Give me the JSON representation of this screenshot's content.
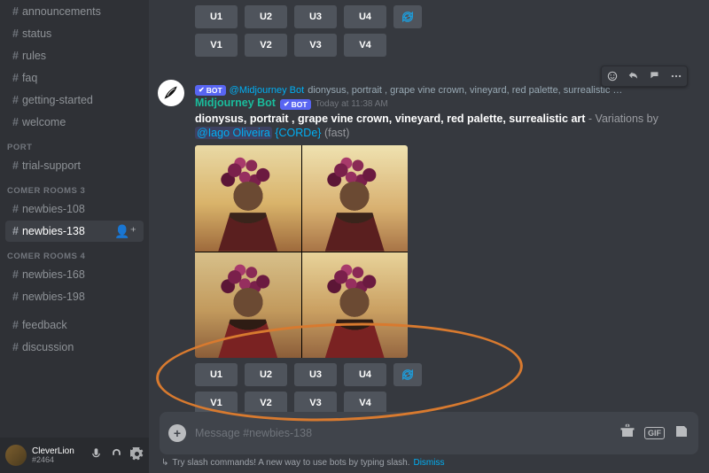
{
  "sidebar": {
    "channels_top": [
      {
        "hash": "#",
        "label": "announcements"
      },
      {
        "hash": "#",
        "label": "status"
      },
      {
        "hash": "#",
        "label": "rules"
      },
      {
        "hash": "#",
        "label": "faq"
      },
      {
        "hash": "#",
        "label": "getting-started"
      },
      {
        "hash": "#",
        "label": "welcome"
      }
    ],
    "section_port": "PORT",
    "port": [
      {
        "hash": "#",
        "label": "trial-support"
      }
    ],
    "section_rooms3": "COMER ROOMS 3",
    "rooms3": [
      {
        "hash": "#",
        "label": "newbies-108"
      },
      {
        "hash": "#",
        "label": "newbies-138",
        "active": true
      }
    ],
    "section_rooms4": "COMER ROOMS 4",
    "rooms4": [
      {
        "hash": "#",
        "label": "newbies-168"
      },
      {
        "hash": "#",
        "label": "newbies-198"
      }
    ],
    "channels_bottom": [
      {
        "hash": "#",
        "label": "feedback"
      },
      {
        "hash": "#",
        "label": "discussion"
      }
    ],
    "user": {
      "name": "CleverLion",
      "tag": "#2464"
    }
  },
  "prev_buttons": {
    "u": [
      "U1",
      "U2",
      "U3",
      "U4"
    ],
    "v": [
      "V1",
      "V2",
      "V3",
      "V4"
    ]
  },
  "message": {
    "reply_mention": "@Midjourney Bot",
    "reply_rest": "dionysus, portrait , grape vine crown, vineyard, red palette, surrealistic …",
    "bot_name": "Midjourney Bot",
    "bot_badge": "BOT",
    "timestamp": "Today at 11:38 AM",
    "prompt": "dionysus, portrait , grape vine crown, vineyard, red palette, surrealistic art",
    "variations_label": " - Variations by ",
    "mention": "@Iago Oliveira",
    "corde": "{CORDe}",
    "fast": " (fast)"
  },
  "buttons": {
    "u": [
      "U1",
      "U2",
      "U3",
      "U4"
    ],
    "v": [
      "V1",
      "V2",
      "V3",
      "V4"
    ]
  },
  "composer": {
    "placeholder": "Message #newbies-138",
    "gif": "GIF"
  },
  "tip": {
    "text": "Try slash commands! A new way to use bots by typing slash.",
    "dismiss": "Dismiss"
  }
}
